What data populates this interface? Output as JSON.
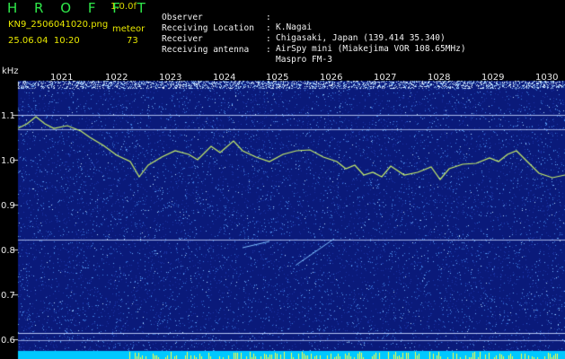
{
  "header": {
    "title": "H R O F F T",
    "version": "1.0.0f",
    "file": "KN9_2506041020.png",
    "datetime": "25.06.04  10:20",
    "meteor_label": "meteor",
    "meteor_count": "73"
  },
  "info": [
    {
      "label": "Observer",
      "value": "K.Nagai"
    },
    {
      "label": "Receiving Location",
      "value": "Chigasaki, Japan (139.414 35.340)"
    },
    {
      "label": "Receiver",
      "value": "AirSpy mini (Miakejima VOR 108.65MHz)"
    },
    {
      "label": "Receiving antenna",
      "value": "Maspro FM-3"
    }
  ],
  "chart_data": {
    "type": "heatmap",
    "ylabel": "kHz",
    "y_ticks": [
      "1.1",
      "1.0",
      "0.9",
      "0.8",
      "0.7",
      "0.6"
    ],
    "x_ticks": [
      "1021",
      "1022",
      "1023",
      "1024",
      "1025",
      "1026",
      "1027",
      "1028",
      "1029",
      "1030"
    ],
    "colors": {
      "background": "#0a1a7a",
      "noise": "#3f7fe0",
      "trace": "#c8f06a",
      "line": "#c8d8ff",
      "bottom": "#00c8ff",
      "bottom_spikes": "#ffff40"
    }
  }
}
